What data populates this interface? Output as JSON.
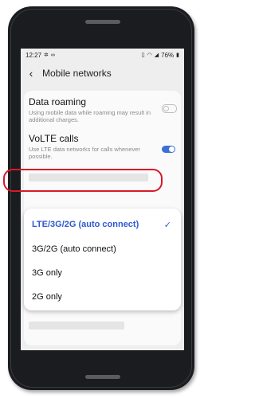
{
  "status_bar": {
    "time": "12:27",
    "left_icons": [
      "settings-icon",
      "link-icon"
    ],
    "right_icons": [
      "vibrate-icon",
      "wifi-icon",
      "signal-icon",
      "battery-icon"
    ],
    "battery": "76%"
  },
  "header": {
    "title": "Mobile networks",
    "back_icon": "arrow-left-icon"
  },
  "settings": [
    {
      "label": "Data roaming",
      "description": "Using mobile data while roaming may result in additional charges.",
      "enabled": false
    },
    {
      "label": "VoLTE calls",
      "description": "Use LTE data networks for calls whenever possible.",
      "enabled": true
    }
  ],
  "network_mode_menu": {
    "options": [
      {
        "label": "LTE/3G/2G (auto connect)",
        "selected": true
      },
      {
        "label": "3G/2G (auto connect)",
        "selected": false
      },
      {
        "label": "3G only",
        "selected": false
      },
      {
        "label": "2G only",
        "selected": false
      }
    ],
    "selected_icon": "checkmark-icon"
  },
  "colors": {
    "accent": "#2f5bd0",
    "highlight": "#d7192a",
    "phone_body": "#1b1c1f"
  }
}
